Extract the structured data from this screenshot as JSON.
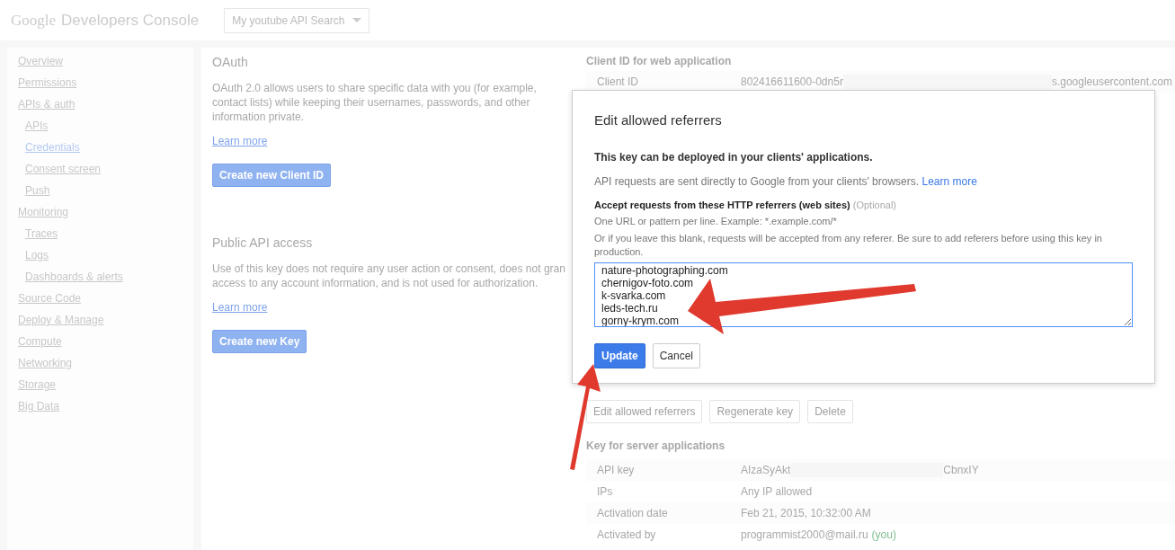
{
  "header": {
    "logo_google": "Google",
    "logo_product": "Developers Console",
    "project": "My youtube API Search"
  },
  "sidebar": {
    "items": [
      {
        "label": "Overview",
        "selected": false
      },
      {
        "label": "Permissions",
        "selected": false
      },
      {
        "label": "APIs & auth",
        "selected": false,
        "children": [
          {
            "label": "APIs",
            "selected": false
          },
          {
            "label": "Credentials",
            "selected": true
          },
          {
            "label": "Consent screen",
            "selected": false
          },
          {
            "label": "Push",
            "selected": false
          }
        ]
      },
      {
        "label": "Monitoring",
        "selected": false,
        "children": [
          {
            "label": "Traces",
            "selected": false
          },
          {
            "label": "Logs",
            "selected": false
          },
          {
            "label": "Dashboards & alerts",
            "selected": false
          }
        ]
      },
      {
        "label": "Source Code",
        "selected": false
      },
      {
        "label": "Deploy & Manage",
        "selected": false
      },
      {
        "label": "Compute",
        "selected": false
      },
      {
        "label": "Networking",
        "selected": false
      },
      {
        "label": "Storage",
        "selected": false
      },
      {
        "label": "Big Data",
        "selected": false
      }
    ]
  },
  "sections": [
    {
      "title": "OAuth",
      "text": [
        "OAuth 2.0 allows users to share specific data with you (for example,",
        "contact lists) while keeping their usernames, passwords, and other",
        "information private."
      ],
      "link": "Learn more",
      "button": "Create new Client ID"
    },
    {
      "title": "Public API access",
      "text": [
        "Use of this key does not require any user action or consent, does not gran",
        "access to any account information, and is not used for authorization."
      ],
      "link": "Learn more",
      "button": "Create new Key"
    }
  ],
  "client_id": {
    "title": "Client ID for web application",
    "rows": [
      {
        "label": "Client ID",
        "value_start": "802416611600-0dn5r",
        "value_end": "s.googleusercontent.com"
      }
    ]
  },
  "browser_key_buttons": [
    "Edit allowed referrers",
    "Regenerate key",
    "Delete"
  ],
  "server_key": {
    "title": "Key for server applications",
    "rows": [
      {
        "label": "API key",
        "value": "AIzaSyAkt",
        "value_end": "CbnxIY"
      },
      {
        "label": "IPs",
        "value": "Any IP allowed"
      },
      {
        "label": "Activation date",
        "value": "Feb 21, 2015, 10:32:00 AM"
      },
      {
        "label": "Activated by",
        "value": "programmist2000@mail.ru",
        "note": "(you)"
      }
    ]
  },
  "dialog": {
    "title": "Edit allowed referrers",
    "lead": "This key can be deployed in your clients' applications.",
    "info": "API requests are sent directly to Google from your clients' browsers.",
    "info_link": "Learn more",
    "field_label": "Accept requests from these HTTP referrers (web sites)",
    "field_optional": "(Optional)",
    "hint1": "One URL or pattern per line. Example: *.example.com/*",
    "hint2": "Or if you leave this blank, requests will be accepted from any referer. Be sure to add referers before using this key in production.",
    "referrers": [
      "nature-photographing.com",
      "chernigov-foto.com",
      "k-svarka.com",
      "leds-tech.ru",
      "gorny-krym.com"
    ],
    "primary_button": "Update",
    "secondary_button": "Cancel"
  }
}
